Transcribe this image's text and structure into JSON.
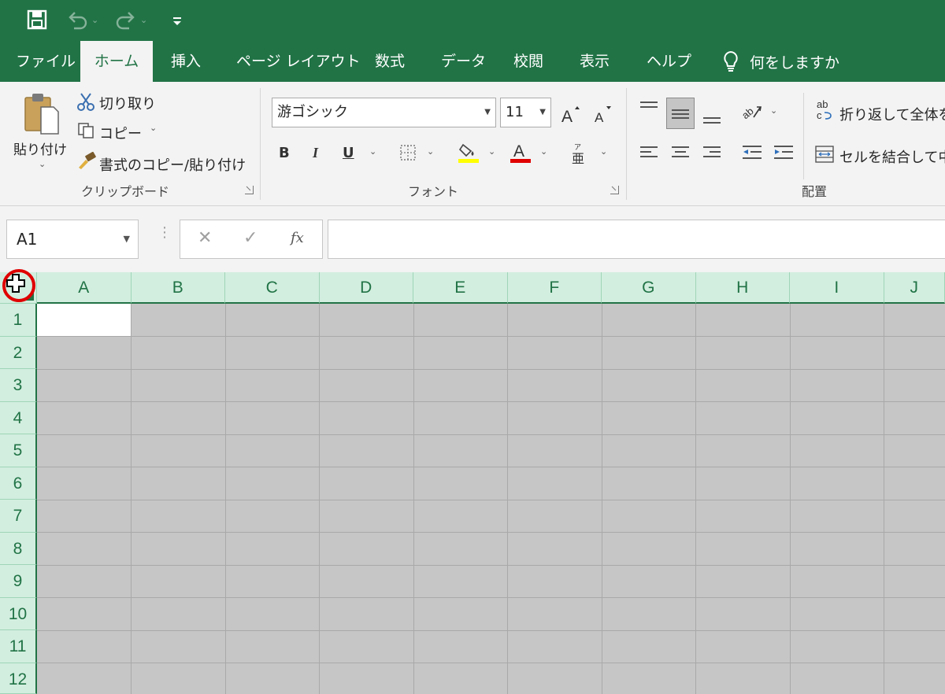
{
  "ribbon_tabs": {
    "file": "ファイル",
    "home": "ホーム",
    "insert": "挿入",
    "page_layout": "ページ レイアウト",
    "formulas": "数式",
    "data": "データ",
    "review": "校閲",
    "view": "表示",
    "help": "ヘルプ"
  },
  "tell_me": "何をしますか",
  "clipboard": {
    "paste": "貼り付け",
    "cut": "切り取り",
    "copy": "コピー",
    "format_painter": "書式のコピー/貼り付け",
    "group_label": "クリップボード"
  },
  "font": {
    "name": "游ゴシック",
    "size": "11",
    "bold": "B",
    "italic": "I",
    "underline": "U",
    "font_color_letter": "A",
    "group_label": "フォント",
    "fill_color": "#ffff00",
    "font_color": "#e00000"
  },
  "alignment": {
    "wrap_text": "折り返して全体を",
    "merge_center": "セルを結合して中",
    "group_label": "配置"
  },
  "formula_bar": {
    "name_box": "A1",
    "fx": "fx",
    "value": ""
  },
  "columns": [
    "A",
    "B",
    "C",
    "D",
    "E",
    "F",
    "G",
    "H",
    "I",
    "J"
  ],
  "rows": [
    "1",
    "2",
    "3",
    "4",
    "5",
    "6",
    "7",
    "8",
    "9",
    "10",
    "11",
    "12"
  ],
  "colors": {
    "accent": "#217346",
    "header_bg": "#d2eedf",
    "selection": "#c6c6c6",
    "highlight_ring": "#e00000"
  },
  "icons": {
    "save": "save-icon",
    "undo": "undo-icon",
    "redo": "redo-icon",
    "customize": "customize-qat-icon",
    "lightbulb": "lightbulb-icon",
    "select_all": "select-all-cursor-icon"
  }
}
